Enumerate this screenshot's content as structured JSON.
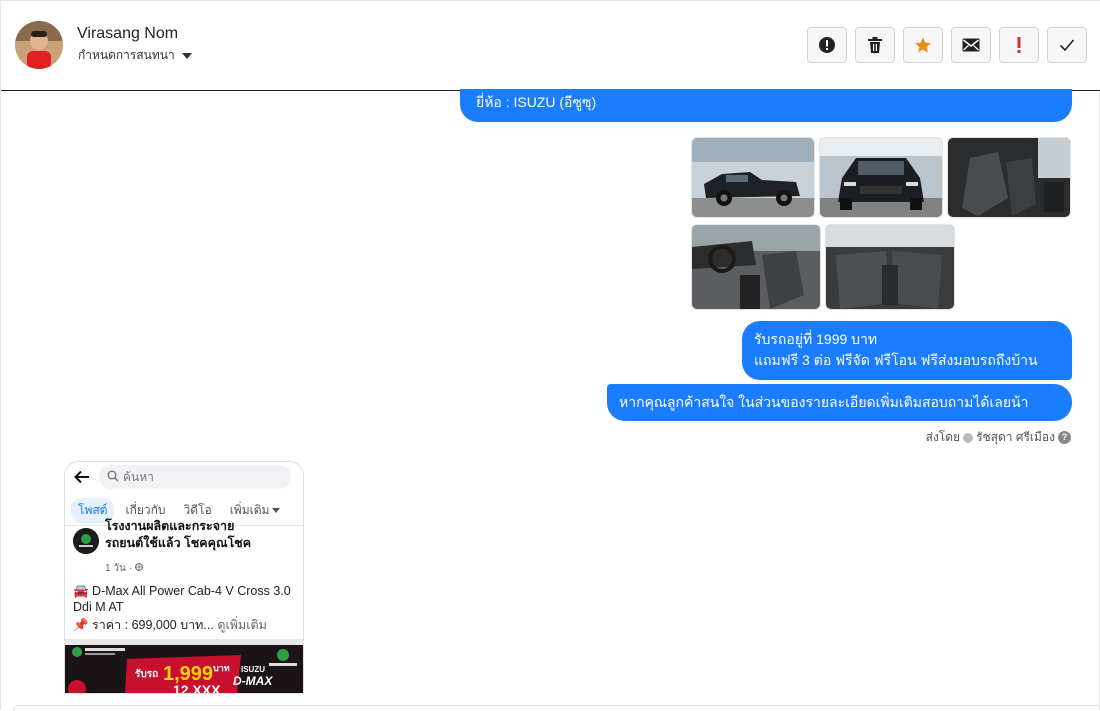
{
  "header": {
    "contact_name": "Virasang Nom",
    "conversation_label": "กำหนดการสนทนา",
    "actions": [
      {
        "name": "alert",
        "color": "#222222"
      },
      {
        "name": "trash",
        "color": "#222222"
      },
      {
        "name": "star",
        "color": "#f08c1a"
      },
      {
        "name": "mail",
        "color": "#222222"
      },
      {
        "name": "exclamation",
        "color": "#d93025"
      },
      {
        "name": "check",
        "color": "#222222"
      }
    ]
  },
  "messages": {
    "brand_line": "ยี่ห้อ : ISUZU (อีซูซุ)",
    "offer_line1": "รับรถอยู่ที่  1999 บาท",
    "offer_line2": "แถมฟรี 3 ต่อ ฟรีจัด ฟรีโอน  ฟรีส่งมอบรถถึงบ้าน",
    "interest_line": "หากคุณลูกค้าสนใจ ในส่วนของรายละเอียดเพิ่มเติมสอบถามได้เลยน้า",
    "sent_by_label": "ส่งโดย",
    "sent_by_name": "รัชสุดา ศรีเมือง"
  },
  "shared_post": {
    "search_placeholder": "ค้นหา",
    "tabs": [
      "โพสต์",
      "เกี่ยวกับ",
      "วิดีโอ",
      "เพิ่มเติม"
    ],
    "page_name_line1": "โรงงานผลิตและกระจาย",
    "page_name_line2": "รถยนต์ใช้แล้ว โชคคุณโชค",
    "meta": "1 วัน ·",
    "title": "🚘 D-Max All  Power Cab-4  V Cross 3.0 Ddi M AT",
    "price": "📌 ราคา : 699,000 บาท...",
    "see_more": "ดูเพิ่มเติม",
    "banner_text1": "1,999",
    "banner_text2": "12,XXX",
    "banner_brand": "ISUZU",
    "banner_model": "D-MAX",
    "banner_receive": "รับรถ",
    "banner_baht": "บาท"
  },
  "colors": {
    "bubble": "#1a7cff",
    "header_divider": "#202124"
  }
}
